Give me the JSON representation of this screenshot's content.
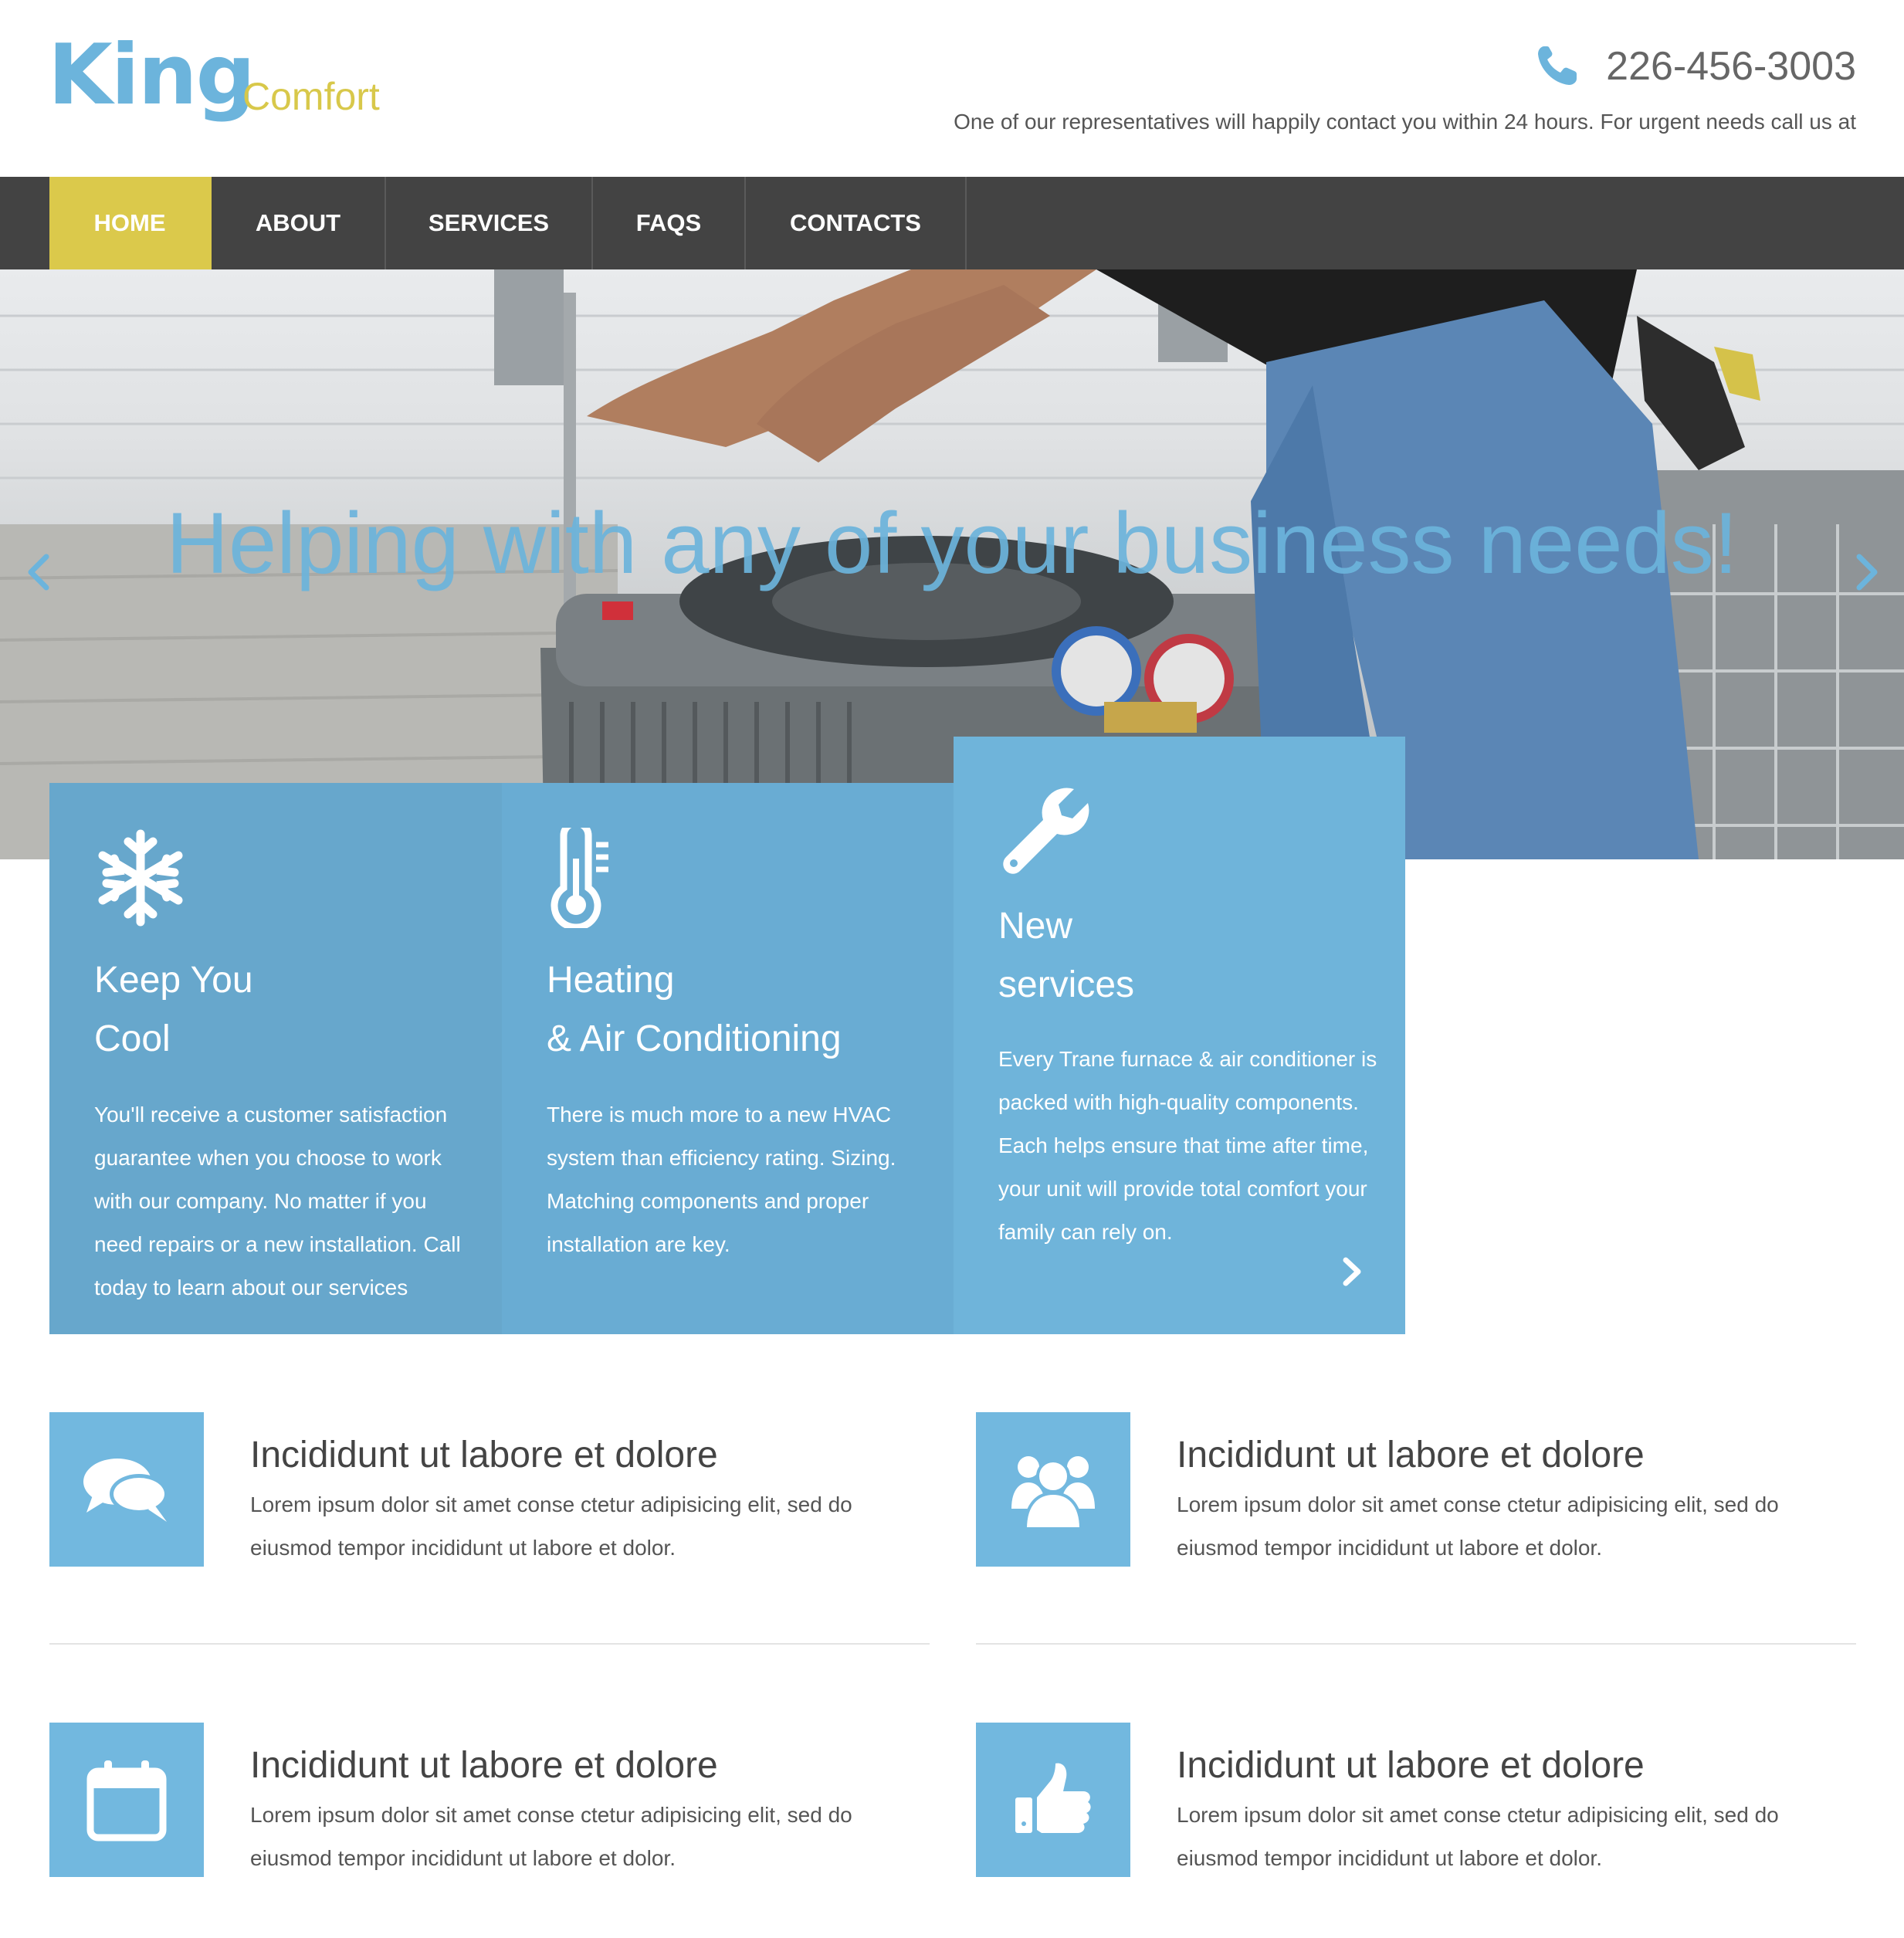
{
  "brand": {
    "name": "King",
    "tagline": "Comfort"
  },
  "header": {
    "phone": "226-456-3003",
    "note": "One of our representatives will happily contact you within 24 hours. For urgent needs call us at"
  },
  "nav": {
    "items": [
      {
        "label": "HOME",
        "active": true
      },
      {
        "label": "ABOUT",
        "active": false
      },
      {
        "label": "SERVICES",
        "active": false
      },
      {
        "label": "FAQS",
        "active": false
      },
      {
        "label": "CONTACTS",
        "active": false
      }
    ]
  },
  "hero": {
    "title": "Helping with any of your business needs!"
  },
  "cards": [
    {
      "icon": "snowflake-icon",
      "title_line1": "Keep You",
      "title_line2": "Cool",
      "body": "You'll receive a customer satisfaction guarantee when you choose to work with our company. No matter if you need repairs or a new installation. Call today to learn about our services"
    },
    {
      "icon": "thermometer-icon",
      "title_line1": "Heating",
      "title_line2": "& Air Conditioning",
      "body": "There is much more to a new HVAC system than efficiency rating. Sizing. Matching components and proper installation are key."
    },
    {
      "icon": "wrench-icon",
      "title_line1": "New",
      "title_line2": "services",
      "body": "Every Trane furnace & air conditioner is packed with high-quality components. Each helps ensure that time after time, your unit will provide total comfort your family can rely on."
    }
  ],
  "features": [
    {
      "icon": "chat-bubbles-icon",
      "title": "Incididunt ut labore et dolore",
      "body": "Lorem ipsum dolor sit amet conse ctetur adipisicing elit, sed do eiusmod tempor incididunt ut labore et dolor."
    },
    {
      "icon": "users-icon",
      "title": "Incididunt ut labore et dolore",
      "body": "Lorem ipsum dolor sit amet conse ctetur adipisicing elit, sed do eiusmod tempor incididunt ut labore et dolor."
    },
    {
      "icon": "calendar-icon",
      "title": "Incididunt ut labore et dolore",
      "body": "Lorem ipsum dolor sit amet conse ctetur adipisicing elit, sed do eiusmod tempor incididunt ut labore et dolor."
    },
    {
      "icon": "thumbs-up-icon",
      "title": "Incididunt ut labore et dolore",
      "body": "Lorem ipsum dolor sit amet conse ctetur adipisicing elit, sed do eiusmod tempor incididunt ut labore et dolor."
    }
  ],
  "colors": {
    "accent_blue": "#6cb4dc",
    "accent_yellow": "#dbc94b",
    "nav_bg": "#434343"
  }
}
